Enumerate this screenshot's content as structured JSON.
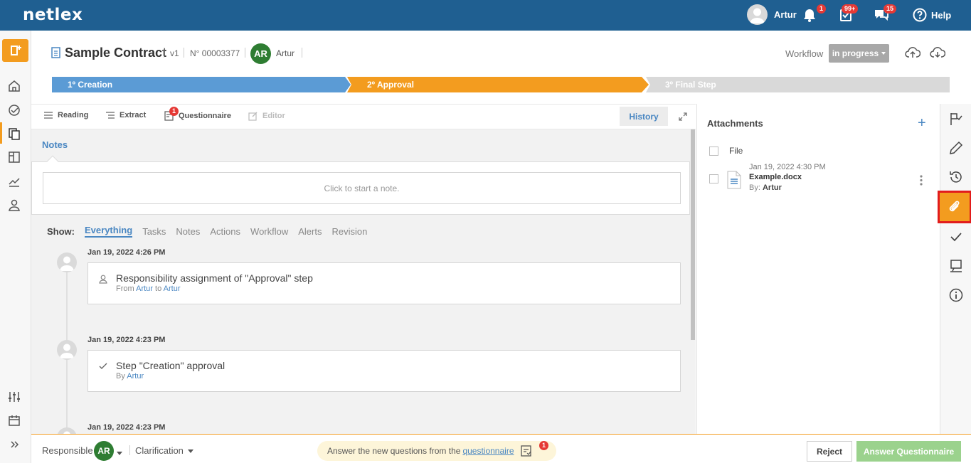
{
  "app": {
    "logo": "netlex"
  },
  "topbar": {
    "user_name": "Artur",
    "notifications_badge": "1",
    "tasks_badge": "99+",
    "messages_badge": "15",
    "help_label": "Help"
  },
  "header": {
    "title": "Sample Contract",
    "version": "v1",
    "number": "N° 00003377",
    "owner_initials": "AR",
    "owner_name": "Artur",
    "workflow_label": "Workflow",
    "workflow_status": "in progress"
  },
  "steps": [
    {
      "label": "1º Creation"
    },
    {
      "label": "2º Approval"
    },
    {
      "label": "3º Final Step"
    }
  ],
  "tabs": {
    "reading": "Reading",
    "extract": "Extract",
    "questionnaire": "Questionnaire",
    "questionnaire_badge": "1",
    "editor": "Editor",
    "history": "History"
  },
  "notes": {
    "tab_label": "Notes",
    "placeholder": "Click to start a note."
  },
  "filters": {
    "show_label": "Show:",
    "items": [
      "Everything",
      "Tasks",
      "Notes",
      "Actions",
      "Workflow",
      "Alerts",
      "Revision"
    ]
  },
  "timeline": [
    {
      "date": "Jan 19, 2022 4:26 PM",
      "title": "Responsibility assignment of \"Approval\" step",
      "sub_prefix": "From",
      "from": "Artur",
      "sub_mid": "to",
      "to": "Artur"
    },
    {
      "date": "Jan 19, 2022 4:23 PM",
      "title": "Step \"Creation\" approval",
      "sub_prefix": "By",
      "by": "Artur"
    },
    {
      "date": "Jan 19, 2022 4:23 PM"
    }
  ],
  "attachments": {
    "title": "Attachments",
    "file_label": "File",
    "items": [
      {
        "date": "Jan 19, 2022 4:30 PM",
        "name": "Example.docx",
        "by_label": "By:",
        "by": "Artur"
      }
    ]
  },
  "bottom": {
    "responsible_label": "Responsible",
    "responsible_initials": "AR",
    "clarification_label": "Clarification",
    "notice_text": "Answer the new questions from the",
    "notice_link": "questionnaire",
    "notice_badge": "1",
    "reject_label": "Reject",
    "answer_label": "Answer Questionnaire"
  },
  "colors": {
    "topbar": "#1f5f91",
    "accent": "#f39c1f",
    "step_done": "#5b9bd5",
    "step_pending": "#d9d9d9",
    "link": "#4a87c2",
    "answer_button": "#9bd28d",
    "highlight_border": "#e21c1c"
  }
}
